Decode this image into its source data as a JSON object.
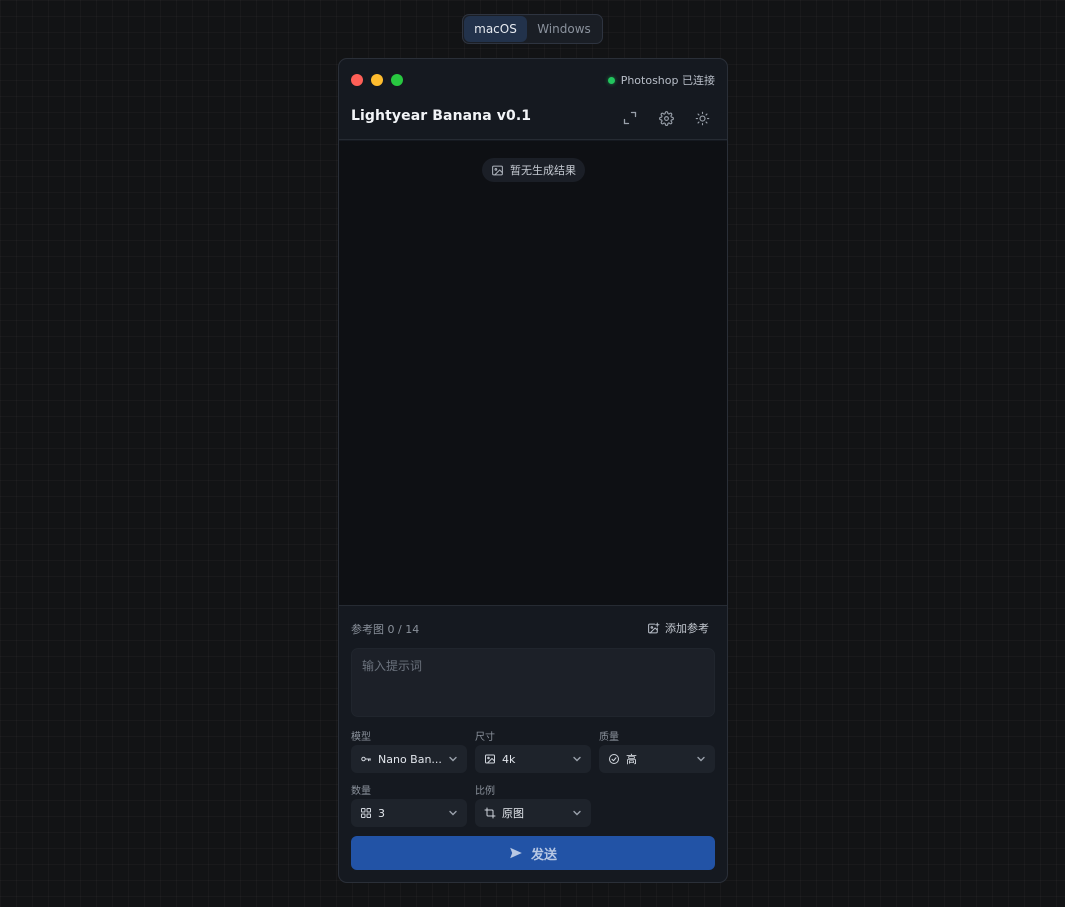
{
  "os_switch": {
    "mac_label": "macOS",
    "windows_label": "Windows"
  },
  "status": {
    "text": "Photoshop 已连接",
    "dot_color": "#22c55e"
  },
  "header": {
    "title": "Lightyear Banana v0.1"
  },
  "canvas": {
    "empty_text": "暂无生成结果"
  },
  "reference": {
    "label": "参考图 0 / 14",
    "add_label": "添加参考"
  },
  "prompt": {
    "placeholder": "输入提示词",
    "value": ""
  },
  "options": {
    "model": {
      "label": "模型",
      "value": "Nano Ban..."
    },
    "size": {
      "label": "尺寸",
      "value": "4k"
    },
    "quality": {
      "label": "质量",
      "value": "高"
    },
    "count": {
      "label": "数量",
      "value": "3"
    },
    "ratio": {
      "label": "比例",
      "value": "原图"
    }
  },
  "send": {
    "label": "发送"
  },
  "colors": {
    "accent": "#2253a6",
    "background": "#121315",
    "window": "#151920"
  }
}
